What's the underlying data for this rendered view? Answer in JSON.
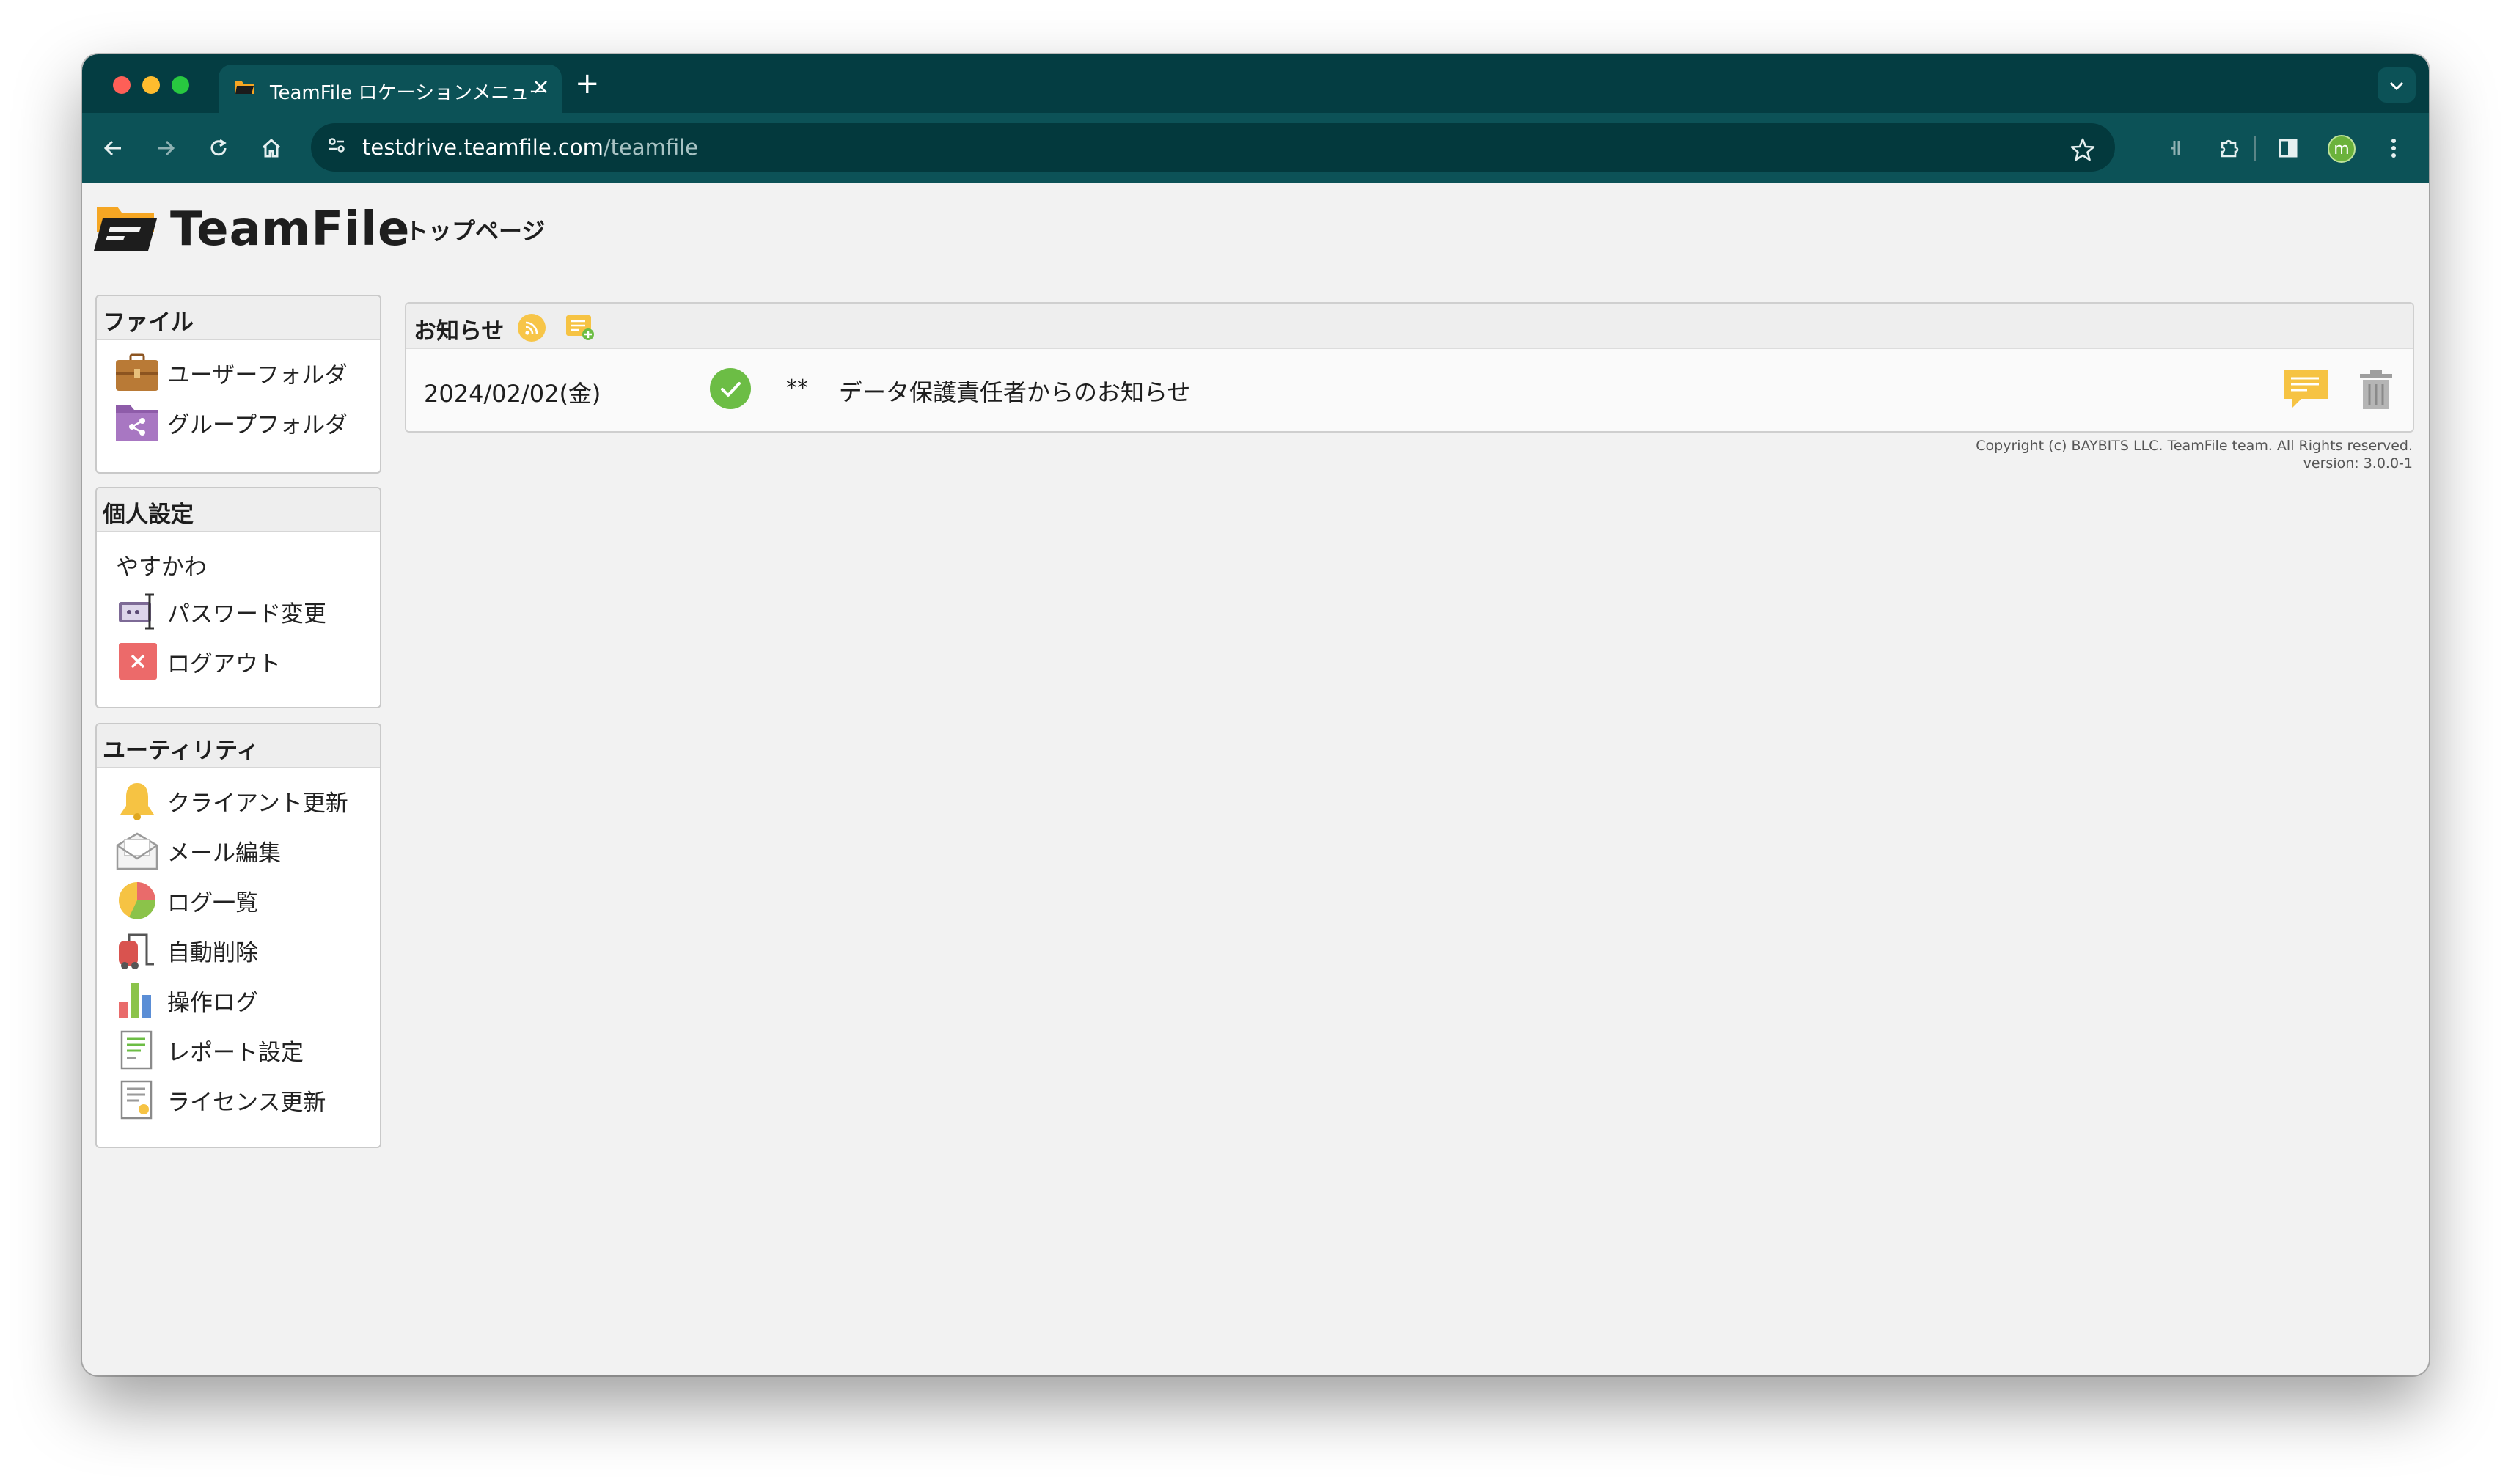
{
  "browser": {
    "tab_title": "TeamFile ロケーションメニュー",
    "tab_close": "×",
    "new_tab": "+",
    "url_host": "testdrive.teamfile.com",
    "url_path": "/teamfile",
    "profile_initial": "m"
  },
  "header": {
    "logo_text": "TeamFile",
    "page_title": "トップページ"
  },
  "sidebar": {
    "file": {
      "title": "ファイル",
      "items": [
        {
          "label": "ユーザーフォルダ",
          "icon": "briefcase-icon"
        },
        {
          "label": "グループフォルダ",
          "icon": "shared-folder-icon"
        }
      ]
    },
    "personal": {
      "title": "個人設定",
      "username": "やすかわ",
      "items": [
        {
          "label": "パスワード変更",
          "icon": "password-icon"
        },
        {
          "label": "ログアウト",
          "icon": "logout-icon"
        }
      ]
    },
    "utility": {
      "title": "ユーティリティ",
      "items": [
        {
          "label": "クライアント更新",
          "icon": "bell-icon"
        },
        {
          "label": "メール編集",
          "icon": "mail-icon"
        },
        {
          "label": "ログ一覧",
          "icon": "pie-chart-icon"
        },
        {
          "label": "自動削除",
          "icon": "vacuum-icon"
        },
        {
          "label": "操作ログ",
          "icon": "bar-chart-icon"
        },
        {
          "label": "レポート設定",
          "icon": "report-icon"
        },
        {
          "label": "ライセンス更新",
          "icon": "license-icon"
        }
      ]
    }
  },
  "notices": {
    "title": "お知らせ",
    "items": [
      {
        "date": "2024/02/02(金)",
        "marker": "**",
        "text": "データ保護責任者からのお知らせ",
        "status": "read"
      }
    ]
  },
  "footer": {
    "copyright": "Copyright (c) BAYBITS LLC. TeamFile team. All Rights reserved.",
    "version": "version: 3.0.0-1"
  },
  "colors": {
    "chrome_dark": "#043d42",
    "chrome_toolbar": "#0c5257",
    "page_bg": "#f2f2f2",
    "check_green": "#6cbd45",
    "accent_yellow": "#f7c548"
  }
}
